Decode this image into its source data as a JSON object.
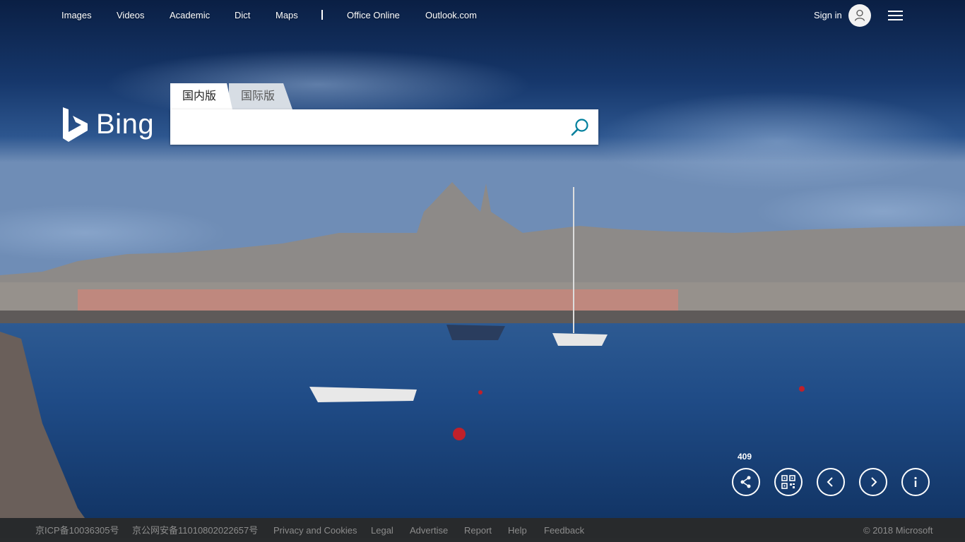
{
  "nav": {
    "links": [
      "Images",
      "Videos",
      "Academic",
      "Dict",
      "Maps",
      "Office Online",
      "Outlook.com"
    ],
    "signin_label": "Sign in"
  },
  "logo": {
    "text": "Bing"
  },
  "search": {
    "tabs": [
      "国内版",
      "国际版"
    ],
    "active_tab": "国内版",
    "value": "",
    "placeholder": ""
  },
  "controls": {
    "share_count": "409",
    "buttons": [
      "share-icon",
      "qr-code-icon",
      "chevron-left-icon",
      "chevron-right-icon",
      "info-icon"
    ]
  },
  "footer": {
    "links": [
      "京ICP备10036305号",
      "京公网安备11010802022657号",
      "Privacy and Cookies",
      "Legal",
      "Advertise",
      "Report",
      "Help",
      "Feedback"
    ],
    "copyright": "© 2018 Microsoft"
  },
  "colors": {
    "accent": "#00809d",
    "footer_bg": "#2b2b2b",
    "footer_text": "#8c8c8c"
  }
}
